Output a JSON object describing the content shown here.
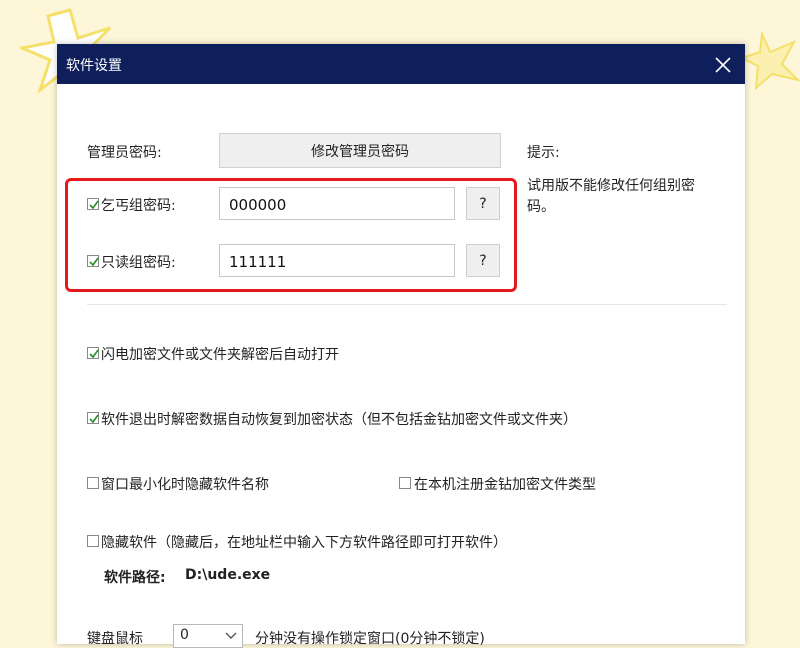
{
  "window": {
    "title": "软件设置"
  },
  "admin": {
    "label": "管理员密码:",
    "change_button": "修改管理员密码"
  },
  "hint": {
    "label": "提示:",
    "text": "试用版不能修改任何组别密码。"
  },
  "groups": [
    {
      "label": "乞丐组密码:",
      "checked": true,
      "value": "000000",
      "help": "?"
    },
    {
      "label": "只读组密码:",
      "checked": true,
      "value": "111111",
      "help": "?"
    }
  ],
  "options": {
    "flash_open": {
      "label": "闪电加密文件或文件夹解密后自动打开",
      "checked": true
    },
    "restore_on_exit": {
      "label": "软件退出时解密数据自动恢复到加密状态（但不包括金钻加密文件或文件夹）",
      "checked": true
    },
    "hide_name_minimized": {
      "label": "窗口最小化时隐藏软件名称",
      "checked": false
    },
    "register_filetype": {
      "label": "在本机注册金钻加密文件类型",
      "checked": false
    },
    "hide_software": {
      "label": "隐藏软件（隐藏后，在地址栏中输入下方软件路径即可打开软件）",
      "checked": false
    }
  },
  "software_path": {
    "label": "软件路径:",
    "value": "D:\\ude.exe"
  },
  "lock": {
    "label": "键盘鼠标",
    "minutes": "0",
    "suffix": "分钟没有操作锁定窗口(0分钟不锁定)"
  },
  "colors": {
    "titlebar": "#0f1f5c",
    "highlight_box": "#e3191c",
    "checkmark": "#2c8a2c"
  }
}
